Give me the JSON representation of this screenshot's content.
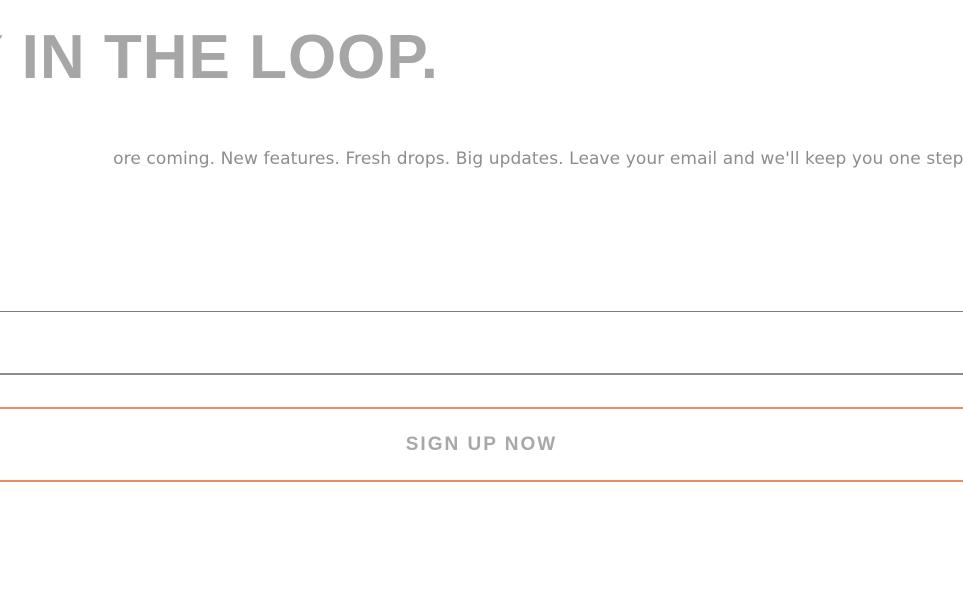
{
  "newsletter": {
    "headline": "Y IN THE LOOP.",
    "subtext": "ore coming. New features. Fresh drops. Big updates. Leave your email and we'll keep you one step ahe",
    "email_input": {
      "value": "",
      "placeholder": ""
    },
    "signup_label": "SIGN UP NOW"
  },
  "colors": {
    "headline": "#a6a6a6",
    "subtext": "#8d8d8d",
    "input_border": "#8c8c8c",
    "button_border": "#ee8a5b",
    "button_text": "#a8a8a8"
  }
}
